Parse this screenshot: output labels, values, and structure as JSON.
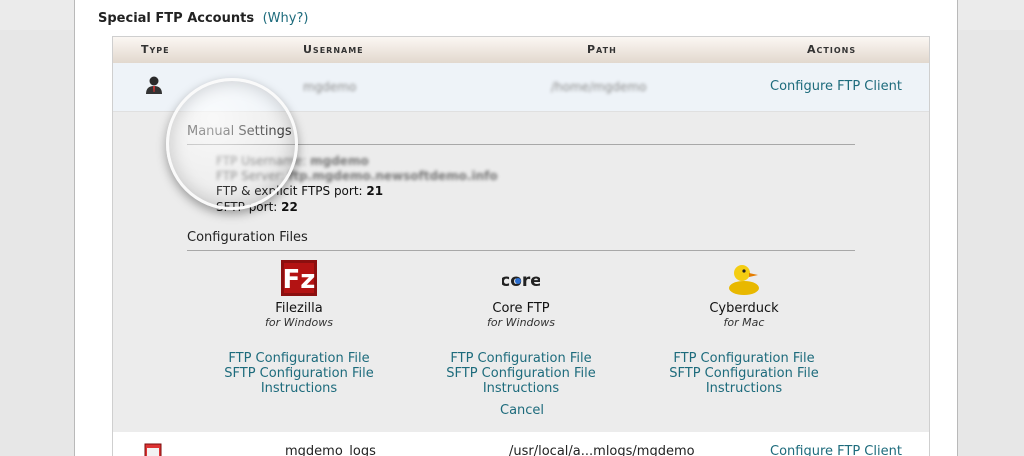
{
  "section": {
    "title": "Special FTP Accounts",
    "why_link": "(Why?)"
  },
  "table": {
    "headers": [
      "Type",
      "Username",
      "Path",
      "Actions"
    ],
    "row1": {
      "username": "mgdemo",
      "path": "/home/mgdemo",
      "action": "Configure FTP Client"
    },
    "row2": {
      "username": "mgdemo_logs",
      "path": "/usr/local/a...mlogs/mgdemo",
      "action": "Configure FTP Client"
    }
  },
  "manual_settings": {
    "heading": "Manual Settings",
    "ftp_username_label": "FTP Username:",
    "ftp_username": "mgdemo",
    "ftp_server_label": "FTP Server:",
    "ftp_server": "ftp.mgdemo.newsoftdemo.info",
    "ftps_port_label": "FTP & explicit FTPS port:",
    "ftps_port": "21",
    "sftp_port_label": "SFTP port:",
    "sftp_port": "22"
  },
  "config_files": {
    "heading": "Configuration Files",
    "clients": [
      {
        "name": "Filezilla",
        "os": "for Windows",
        "icon": "filezilla-icon"
      },
      {
        "name": "Core FTP",
        "os": "for Windows",
        "icon": "coreftp-icon"
      },
      {
        "name": "Cyberduck",
        "os": "for Mac",
        "icon": "cyberduck-icon"
      }
    ],
    "ftp_config_label": "FTP Configuration File",
    "sftp_config_label": "SFTP Configuration File",
    "instructions_label": "Instructions",
    "cancel_label": "Cancel"
  },
  "colors": {
    "link": "#1d6b7c",
    "row_highlight": "#eef3f8",
    "panel": "#ececec"
  }
}
